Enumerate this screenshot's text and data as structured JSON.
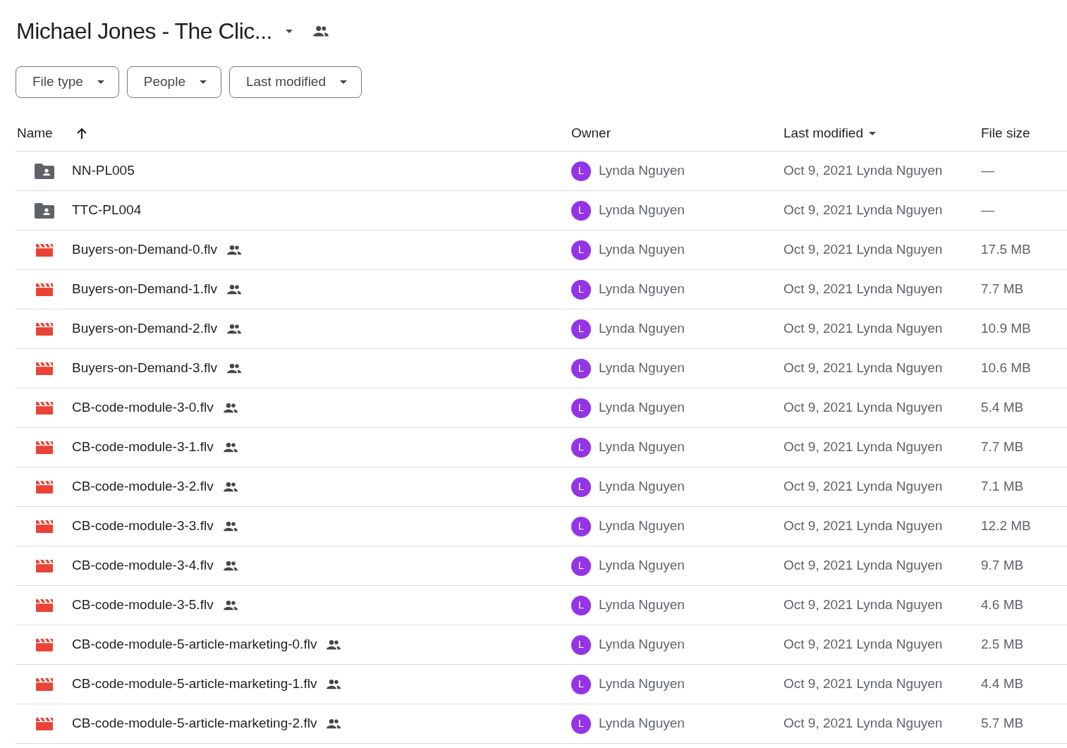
{
  "title": "Michael Jones - The Clic...",
  "filters": [
    "File type",
    "People",
    "Last modified"
  ],
  "columns": {
    "name": "Name",
    "owner": "Owner",
    "modified": "Last modified",
    "size": "File size"
  },
  "rows": [
    {
      "kind": "folder",
      "name": "NN-PL005",
      "shared": false,
      "owner_initial": "L",
      "owner": "Lynda Nguyen",
      "modified": "Oct 9, 2021 Lynda Nguyen",
      "size": "—"
    },
    {
      "kind": "folder",
      "name": "TTC-PL004",
      "shared": false,
      "owner_initial": "L",
      "owner": "Lynda Nguyen",
      "modified": "Oct 9, 2021 Lynda Nguyen",
      "size": "—"
    },
    {
      "kind": "video",
      "name": "Buyers-on-Demand-0.flv",
      "shared": true,
      "owner_initial": "L",
      "owner": "Lynda Nguyen",
      "modified": "Oct 9, 2021 Lynda Nguyen",
      "size": "17.5 MB"
    },
    {
      "kind": "video",
      "name": "Buyers-on-Demand-1.flv",
      "shared": true,
      "owner_initial": "L",
      "owner": "Lynda Nguyen",
      "modified": "Oct 9, 2021 Lynda Nguyen",
      "size": "7.7 MB"
    },
    {
      "kind": "video",
      "name": "Buyers-on-Demand-2.flv",
      "shared": true,
      "owner_initial": "L",
      "owner": "Lynda Nguyen",
      "modified": "Oct 9, 2021 Lynda Nguyen",
      "size": "10.9 MB"
    },
    {
      "kind": "video",
      "name": "Buyers-on-Demand-3.flv",
      "shared": true,
      "owner_initial": "L",
      "owner": "Lynda Nguyen",
      "modified": "Oct 9, 2021 Lynda Nguyen",
      "size": "10.6 MB"
    },
    {
      "kind": "video",
      "name": "CB-code-module-3-0.flv",
      "shared": true,
      "owner_initial": "L",
      "owner": "Lynda Nguyen",
      "modified": "Oct 9, 2021 Lynda Nguyen",
      "size": "5.4 MB"
    },
    {
      "kind": "video",
      "name": "CB-code-module-3-1.flv",
      "shared": true,
      "owner_initial": "L",
      "owner": "Lynda Nguyen",
      "modified": "Oct 9, 2021 Lynda Nguyen",
      "size": "7.7 MB"
    },
    {
      "kind": "video",
      "name": "CB-code-module-3-2.flv",
      "shared": true,
      "owner_initial": "L",
      "owner": "Lynda Nguyen",
      "modified": "Oct 9, 2021 Lynda Nguyen",
      "size": "7.1 MB"
    },
    {
      "kind": "video",
      "name": "CB-code-module-3-3.flv",
      "shared": true,
      "owner_initial": "L",
      "owner": "Lynda Nguyen",
      "modified": "Oct 9, 2021 Lynda Nguyen",
      "size": "12.2 MB"
    },
    {
      "kind": "video",
      "name": "CB-code-module-3-4.flv",
      "shared": true,
      "owner_initial": "L",
      "owner": "Lynda Nguyen",
      "modified": "Oct 9, 2021 Lynda Nguyen",
      "size": "9.7 MB"
    },
    {
      "kind": "video",
      "name": "CB-code-module-3-5.flv",
      "shared": true,
      "owner_initial": "L",
      "owner": "Lynda Nguyen",
      "modified": "Oct 9, 2021 Lynda Nguyen",
      "size": "4.6 MB"
    },
    {
      "kind": "video",
      "name": "CB-code-module-5-article-marketing-0.flv",
      "shared": true,
      "owner_initial": "L",
      "owner": "Lynda Nguyen",
      "modified": "Oct 9, 2021 Lynda Nguyen",
      "size": "2.5 MB"
    },
    {
      "kind": "video",
      "name": "CB-code-module-5-article-marketing-1.flv",
      "shared": true,
      "owner_initial": "L",
      "owner": "Lynda Nguyen",
      "modified": "Oct 9, 2021 Lynda Nguyen",
      "size": "4.4 MB"
    },
    {
      "kind": "video",
      "name": "CB-code-module-5-article-marketing-2.flv",
      "shared": true,
      "owner_initial": "L",
      "owner": "Lynda Nguyen",
      "modified": "Oct 9, 2021 Lynda Nguyen",
      "size": "5.7 MB"
    }
  ]
}
